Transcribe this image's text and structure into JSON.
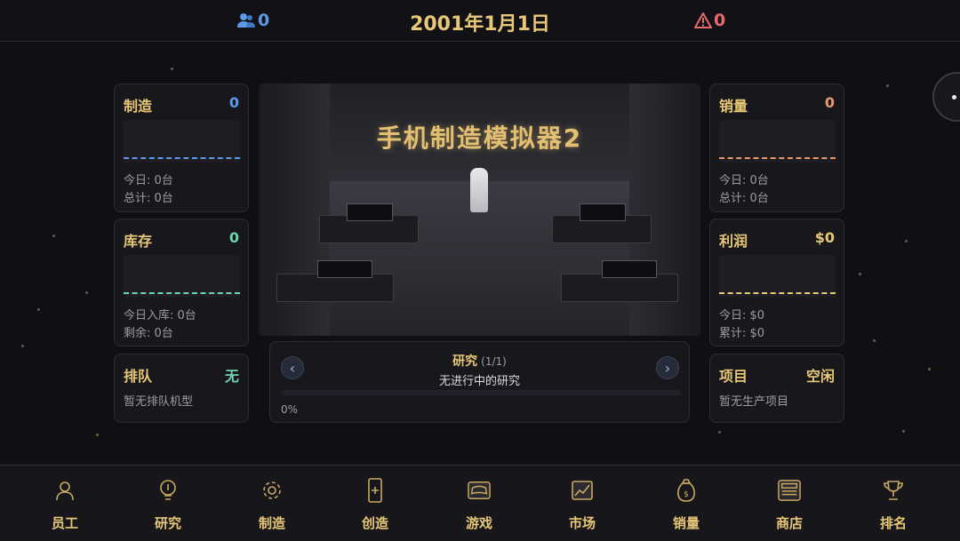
{
  "top": {
    "staff_count": "0",
    "date": "2001年1月1日",
    "alert_count": "0"
  },
  "left_cards": {
    "manufacture": {
      "title": "制造",
      "value": "0",
      "line1": "今日: 0台",
      "line2": "总计: 0台"
    },
    "inventory": {
      "title": "库存",
      "value": "0",
      "line1": "今日入库: 0台",
      "line2": "剩余: 0台"
    },
    "queue": {
      "title": "排队",
      "value": "无",
      "line1": "暂无排队机型"
    }
  },
  "right_cards": {
    "sales": {
      "title": "销量",
      "value": "0",
      "line1": "今日: 0台",
      "line2": "总计: 0台"
    },
    "profit": {
      "title": "利润",
      "value": "$0",
      "line1": "今日: $0",
      "line2": "累计: $0"
    },
    "project": {
      "title": "项目",
      "value": "空闲",
      "line1": "暂无生产项目"
    }
  },
  "hero": {
    "title": "手机制造模拟器2"
  },
  "research": {
    "title": "研究",
    "count": "(1/1)",
    "status": "无进行中的研究",
    "progress_label": "0%",
    "progress_fraction": 0,
    "prev_symbol": "‹",
    "next_symbol": "›"
  },
  "bottom_nav": [
    {
      "label": "员工",
      "icon": "employee-icon"
    },
    {
      "label": "研究",
      "icon": "lightbulb-icon"
    },
    {
      "label": "制造",
      "icon": "gear-icon"
    },
    {
      "label": "创造",
      "icon": "phone-icon"
    },
    {
      "label": "游戏",
      "icon": "gamepad-icon"
    },
    {
      "label": "市场",
      "icon": "chart-icon"
    },
    {
      "label": "销量",
      "icon": "money-bag-icon"
    },
    {
      "label": "商店",
      "icon": "store-icon"
    },
    {
      "label": "排名",
      "icon": "trophy-icon"
    }
  ],
  "colors": {
    "gold": "#e8c877",
    "blue": "#5b9be8",
    "red": "#e86a6a",
    "teal": "#6ed4b0",
    "orange": "#e89a6a"
  }
}
